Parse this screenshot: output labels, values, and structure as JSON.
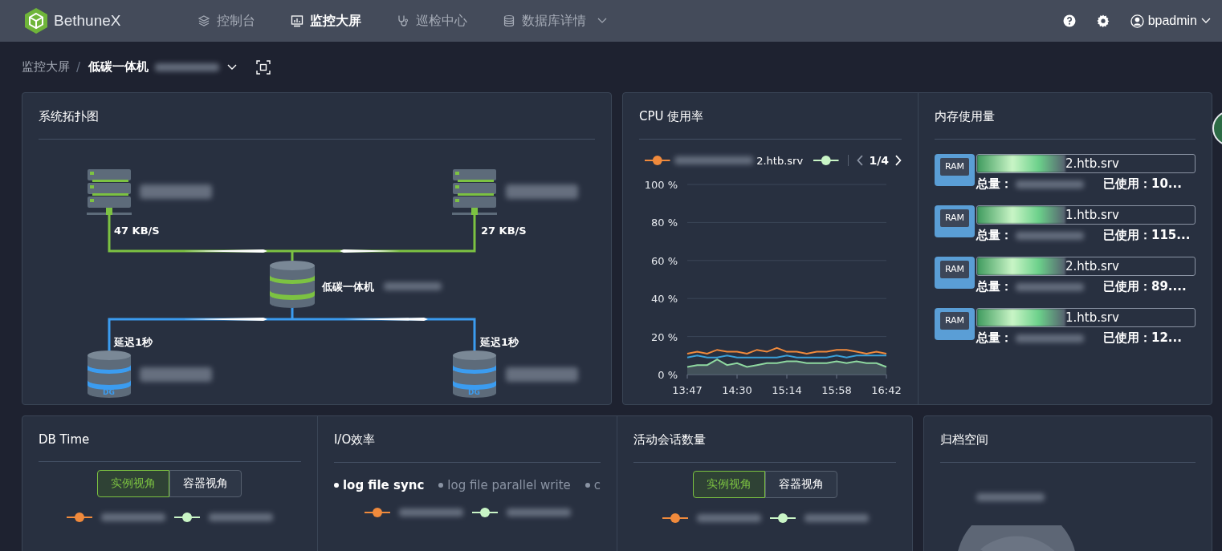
{
  "nav": {
    "brand": "BethuneX",
    "items": [
      {
        "label": "控制台",
        "selected": false,
        "dropdown": false
      },
      {
        "label": "监控大屏",
        "selected": true,
        "dropdown": false
      },
      {
        "label": "巡检中心",
        "selected": false,
        "dropdown": false
      },
      {
        "label": "数据库详情",
        "selected": false,
        "dropdown": true
      }
    ],
    "user": "bpadmin"
  },
  "breadcrumb": {
    "items": [
      "监控大屏",
      "低碳一体机"
    ],
    "separator": "/"
  },
  "topology": {
    "title": "系统拓扑图",
    "primaries": [
      {
        "rate": "47 KB/S"
      },
      {
        "rate": "27 KB/S"
      }
    ],
    "center": "低碳一体机",
    "standbys": [
      {
        "delay": "延迟1秒",
        "badge": "DG"
      },
      {
        "delay": "延迟1秒",
        "badge": "DG"
      }
    ]
  },
  "cpu": {
    "title": "CPU 使用率",
    "legend": [
      {
        "label": "2.htb.srv",
        "color": "#f08a3c"
      },
      {
        "color": "#c9f5c6"
      }
    ],
    "pager": "1/4",
    "chart_data": {
      "type": "line",
      "categories": [
        "13:47",
        null,
        null,
        null,
        null,
        "14:30",
        null,
        null,
        null,
        null,
        "15:14",
        null,
        null,
        null,
        null,
        "15:58",
        null,
        null,
        null,
        null,
        "16:42"
      ],
      "grid": true,
      "ylim": [
        0,
        100
      ],
      "yticks": [
        {
          "value": 0,
          "label": "0 %"
        },
        {
          "value": 20,
          "label": "20 %"
        },
        {
          "value": 40,
          "label": "40 %"
        },
        {
          "value": 60,
          "label": "60 %"
        },
        {
          "value": 80,
          "label": "80 %"
        },
        {
          "value": 100,
          "label": "100 %"
        }
      ],
      "series": [
        {
          "color": "#f08a3c",
          "values": [
            11,
            12,
            11,
            13,
            12,
            12,
            11,
            13,
            12,
            14,
            12,
            12,
            11,
            12,
            12,
            13,
            13,
            12,
            11,
            12,
            11
          ]
        },
        {
          "color": "#3aa0d8",
          "values": [
            9,
            10,
            9,
            9,
            10,
            9,
            9,
            9,
            9,
            9,
            10,
            9,
            9,
            9,
            9,
            10,
            9,
            10,
            10,
            10,
            10
          ]
        },
        {
          "color": "#8fd8a0",
          "values": [
            4,
            5,
            5,
            8,
            5,
            6,
            4,
            5,
            6,
            6,
            7,
            7,
            6,
            6,
            6,
            7,
            6,
            7,
            6,
            6,
            4
          ]
        }
      ]
    }
  },
  "memory": {
    "title": "内存使用量",
    "items": [
      {
        "chip": "RAM",
        "name": "2.htb.srv",
        "total_label": "总量：",
        "used": "已使用：10..."
      },
      {
        "chip": "RAM",
        "name": "1.htb.srv",
        "total_label": "总量：",
        "used": "已使用：115..."
      },
      {
        "chip": "RAM",
        "name": "2.htb.srv",
        "total_label": "总量：",
        "used": "已使用：89...."
      },
      {
        "chip": "RAM",
        "name": "1.htb.srv",
        "total_label": "总量：",
        "used": "已使用：12..."
      }
    ]
  },
  "db_time": {
    "title": "DB Time",
    "toggle": [
      {
        "label": "实例视角",
        "selected": true
      },
      {
        "label": "容器视角",
        "selected": false
      }
    ],
    "legend": [
      {
        "color": "#f08a3c"
      },
      {
        "color": "#c9f5c6"
      }
    ]
  },
  "io": {
    "title": "I/O效率",
    "tabs": [
      {
        "label": "log file sync",
        "selected": true
      },
      {
        "label": "log file parallel write",
        "selected": false
      },
      {
        "label": "c",
        "selected": false
      }
    ],
    "legend": [
      {
        "color": "#f08a3c"
      },
      {
        "color": "#c9f5c6"
      }
    ]
  },
  "sessions": {
    "title": "活动会话数量",
    "toggle": [
      {
        "label": "实例视角",
        "selected": true
      },
      {
        "label": "容器视角",
        "selected": false
      }
    ],
    "legend": [
      {
        "color": "#f08a3c"
      },
      {
        "color": "#c9f5c6"
      }
    ]
  },
  "archive": {
    "title": "归档空间"
  }
}
